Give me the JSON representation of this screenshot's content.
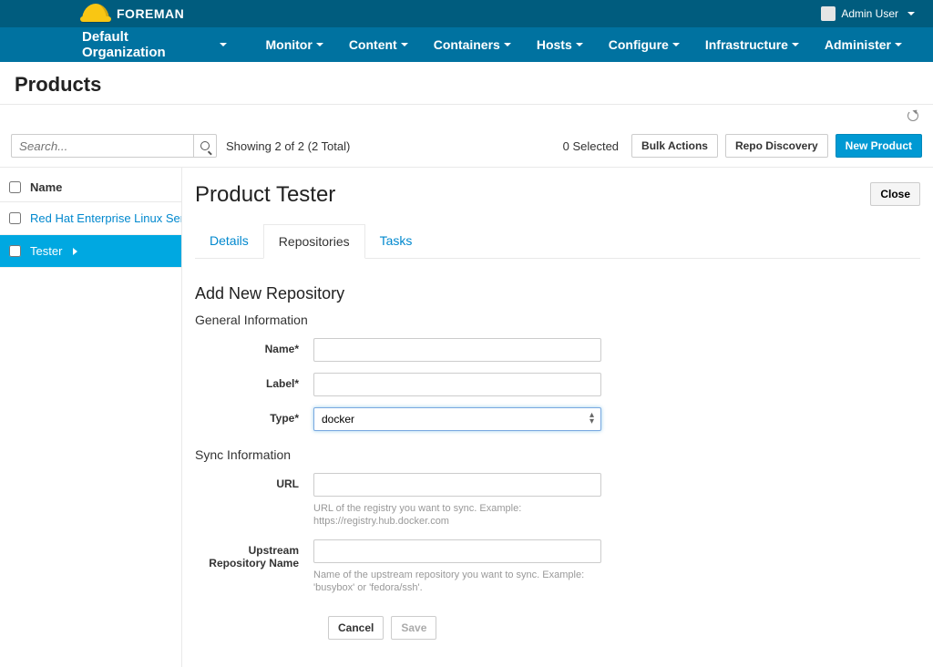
{
  "brand": "FOREMAN",
  "user": {
    "name": "Admin User"
  },
  "org": {
    "name": "Default Organization"
  },
  "nav": {
    "monitor": "Monitor",
    "content": "Content",
    "containers": "Containers",
    "hosts": "Hosts",
    "configure": "Configure",
    "infrastructure": "Infrastructure",
    "administer": "Administer"
  },
  "page": {
    "title": "Products"
  },
  "toolbar": {
    "search_placeholder": "Search...",
    "showing": "Showing 2 of 2 (2 Total)",
    "selected": "0 Selected",
    "bulk_actions": "Bulk Actions",
    "repo_discovery": "Repo Discovery",
    "new_product": "New Product"
  },
  "sidebar": {
    "name_header": "Name",
    "rows": [
      {
        "label": "Red Hat Enterprise Linux Serv",
        "active": false
      },
      {
        "label": "Tester",
        "active": true
      }
    ]
  },
  "detail": {
    "title": "Product Tester",
    "close": "Close",
    "tabs": {
      "details": "Details",
      "repositories": "Repositories",
      "tasks": "Tasks"
    },
    "section_title": "Add New Repository",
    "general_info": "General Information",
    "sync_info": "Sync Information",
    "labels": {
      "name": "Name*",
      "label": "Label*",
      "type": "Type*",
      "url": "URL",
      "upstream": "Upstream Repository Name"
    },
    "type_value": "docker",
    "url_help": "URL of the registry you want to sync. Example: https://registry.hub.docker.com",
    "upstream_help": "Name of the upstream repository you want to sync. Example: 'busybox' or 'fedora/ssh'.",
    "cancel": "Cancel",
    "save": "Save"
  }
}
